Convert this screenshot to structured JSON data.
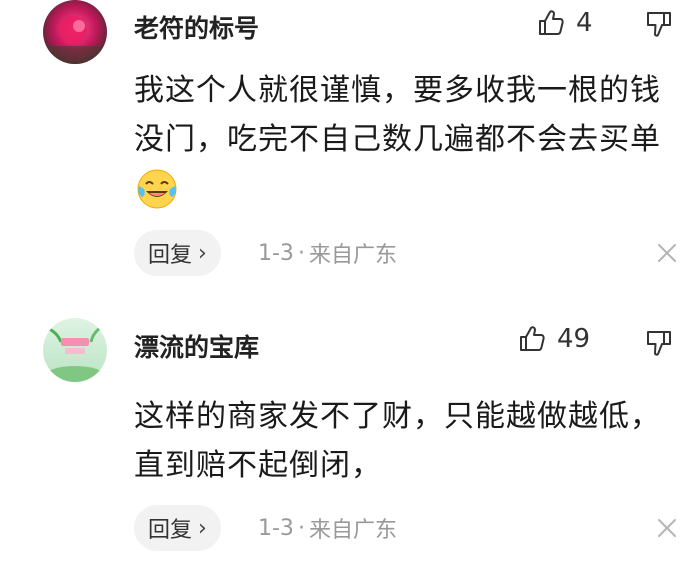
{
  "comments": [
    {
      "username": "老符的标号",
      "likes": "4",
      "lines": [
        "我这个人就很谨慎，要多收我一根的钱",
        "没门，吃完不自己数几遍都不会去买单"
      ],
      "has_emoji": true,
      "emoji_icon": "laughing-crying-face-icon",
      "reply_label": "回复",
      "reply_chevron": "›",
      "date": "1-3",
      "separator": "·",
      "location": "来自广东",
      "avatar_color": "#d81b60"
    },
    {
      "username": "漂流的宝库",
      "likes": "49",
      "lines": [
        "这样的商家发不了财，只能越做越低，",
        "直到赔不起倒闭，"
      ],
      "has_emoji": false,
      "reply_label": "回复",
      "reply_chevron": "›",
      "date": "1-3",
      "separator": "·",
      "location": "来自广东",
      "avatar_color": "#7cc08a"
    }
  ],
  "colors": {
    "text": "#1a1a1a",
    "meta": "#999999",
    "reply_bg": "#f2f2f2"
  }
}
